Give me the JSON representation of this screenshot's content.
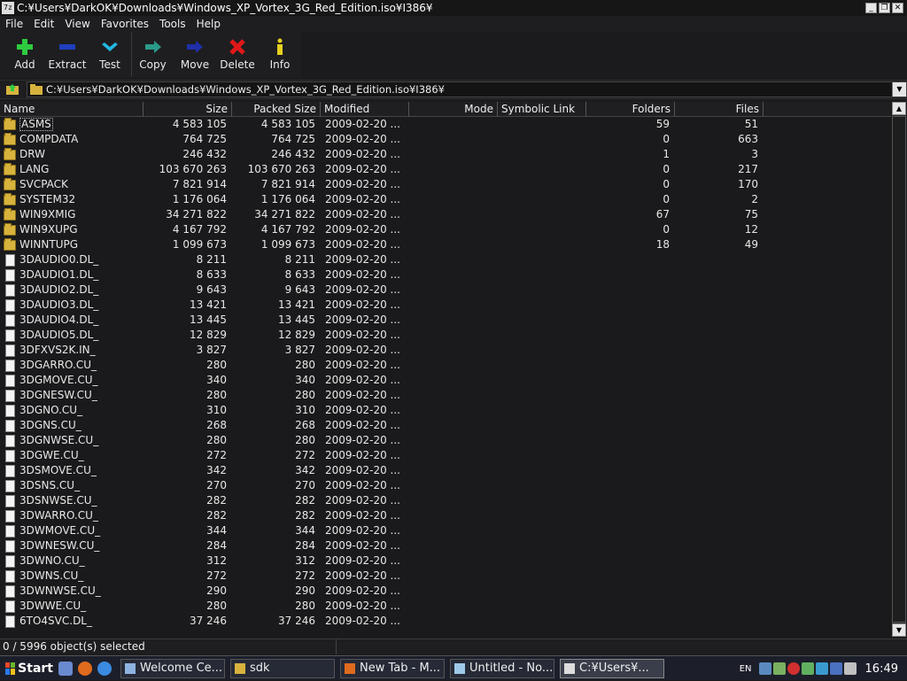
{
  "window": {
    "title": "C:¥Users¥DarkOK¥Downloads¥Windows_XP_Vortex_3G_Red_Edition.iso¥I386¥"
  },
  "menu": [
    "File",
    "Edit",
    "View",
    "Favorites",
    "Tools",
    "Help"
  ],
  "toolbar": [
    {
      "label": "Add",
      "icon": "plus-icon",
      "color": "#2ecc40"
    },
    {
      "label": "Extract",
      "icon": "minus-icon",
      "color": "#1f3fbf"
    },
    {
      "label": "Test",
      "icon": "check-icon",
      "color": "#22b8e0"
    },
    {
      "label": "Copy",
      "icon": "copy-arrow-icon",
      "color": "#2a9a8a"
    },
    {
      "label": "Move",
      "icon": "move-arrow-icon",
      "color": "#1f2fa8"
    },
    {
      "label": "Delete",
      "icon": "delete-x-icon",
      "color": "#e01818"
    },
    {
      "label": "Info",
      "icon": "info-icon",
      "color": "#e8d020"
    }
  ],
  "address": {
    "path": "C:¥Users¥DarkOK¥Downloads¥Windows_XP_Vortex_3G_Red_Edition.iso¥I386¥"
  },
  "columns": {
    "name": "Name",
    "size": "Size",
    "packed": "Packed Size",
    "modified": "Modified",
    "mode": "Mode",
    "symlink": "Symbolic Link",
    "folders": "Folders",
    "files": "Files"
  },
  "rows": [
    {
      "type": "folder",
      "name": "ASMS",
      "size": "4 583 105",
      "packed": "4 583 105",
      "modified": "2009-02-20 ...",
      "folders": "59",
      "files": "51"
    },
    {
      "type": "folder",
      "name": "COMPDATA",
      "size": "764 725",
      "packed": "764 725",
      "modified": "2009-02-20 ...",
      "folders": "0",
      "files": "663"
    },
    {
      "type": "folder",
      "name": "DRW",
      "size": "246 432",
      "packed": "246 432",
      "modified": "2009-02-20 ...",
      "folders": "1",
      "files": "3"
    },
    {
      "type": "folder",
      "name": "LANG",
      "size": "103 670 263",
      "packed": "103 670 263",
      "modified": "2009-02-20 ...",
      "folders": "0",
      "files": "217"
    },
    {
      "type": "folder",
      "name": "SVCPACK",
      "size": "7 821 914",
      "packed": "7 821 914",
      "modified": "2009-02-20 ...",
      "folders": "0",
      "files": "170"
    },
    {
      "type": "folder",
      "name": "SYSTEM32",
      "size": "1 176 064",
      "packed": "1 176 064",
      "modified": "2009-02-20 ...",
      "folders": "0",
      "files": "2"
    },
    {
      "type": "folder",
      "name": "WIN9XMIG",
      "size": "34 271 822",
      "packed": "34 271 822",
      "modified": "2009-02-20 ...",
      "folders": "67",
      "files": "75"
    },
    {
      "type": "folder",
      "name": "WIN9XUPG",
      "size": "4 167 792",
      "packed": "4 167 792",
      "modified": "2009-02-20 ...",
      "folders": "0",
      "files": "12"
    },
    {
      "type": "folder",
      "name": "WINNTUPG",
      "size": "1 099 673",
      "packed": "1 099 673",
      "modified": "2009-02-20 ...",
      "folders": "18",
      "files": "49"
    },
    {
      "type": "file",
      "name": "3DAUDIO0.DL_",
      "size": "8 211",
      "packed": "8 211",
      "modified": "2009-02-20 ...",
      "folders": "",
      "files": ""
    },
    {
      "type": "file",
      "name": "3DAUDIO1.DL_",
      "size": "8 633",
      "packed": "8 633",
      "modified": "2009-02-20 ...",
      "folders": "",
      "files": ""
    },
    {
      "type": "file",
      "name": "3DAUDIO2.DL_",
      "size": "9 643",
      "packed": "9 643",
      "modified": "2009-02-20 ...",
      "folders": "",
      "files": ""
    },
    {
      "type": "file",
      "name": "3DAUDIO3.DL_",
      "size": "13 421",
      "packed": "13 421",
      "modified": "2009-02-20 ...",
      "folders": "",
      "files": ""
    },
    {
      "type": "file",
      "name": "3DAUDIO4.DL_",
      "size": "13 445",
      "packed": "13 445",
      "modified": "2009-02-20 ...",
      "folders": "",
      "files": ""
    },
    {
      "type": "file",
      "name": "3DAUDIO5.DL_",
      "size": "12 829",
      "packed": "12 829",
      "modified": "2009-02-20 ...",
      "folders": "",
      "files": ""
    },
    {
      "type": "file",
      "name": "3DFXVS2K.IN_",
      "size": "3 827",
      "packed": "3 827",
      "modified": "2009-02-20 ...",
      "folders": "",
      "files": ""
    },
    {
      "type": "file",
      "name": "3DGARRO.CU_",
      "size": "280",
      "packed": "280",
      "modified": "2009-02-20 ...",
      "folders": "",
      "files": ""
    },
    {
      "type": "file",
      "name": "3DGMOVE.CU_",
      "size": "340",
      "packed": "340",
      "modified": "2009-02-20 ...",
      "folders": "",
      "files": ""
    },
    {
      "type": "file",
      "name": "3DGNESW.CU_",
      "size": "280",
      "packed": "280",
      "modified": "2009-02-20 ...",
      "folders": "",
      "files": ""
    },
    {
      "type": "file",
      "name": "3DGNO.CU_",
      "size": "310",
      "packed": "310",
      "modified": "2009-02-20 ...",
      "folders": "",
      "files": ""
    },
    {
      "type": "file",
      "name": "3DGNS.CU_",
      "size": "268",
      "packed": "268",
      "modified": "2009-02-20 ...",
      "folders": "",
      "files": ""
    },
    {
      "type": "file",
      "name": "3DGNWSE.CU_",
      "size": "280",
      "packed": "280",
      "modified": "2009-02-20 ...",
      "folders": "",
      "files": ""
    },
    {
      "type": "file",
      "name": "3DGWE.CU_",
      "size": "272",
      "packed": "272",
      "modified": "2009-02-20 ...",
      "folders": "",
      "files": ""
    },
    {
      "type": "file",
      "name": "3DSMOVE.CU_",
      "size": "342",
      "packed": "342",
      "modified": "2009-02-20 ...",
      "folders": "",
      "files": ""
    },
    {
      "type": "file",
      "name": "3DSNS.CU_",
      "size": "270",
      "packed": "270",
      "modified": "2009-02-20 ...",
      "folders": "",
      "files": ""
    },
    {
      "type": "file",
      "name": "3DSNWSE.CU_",
      "size": "282",
      "packed": "282",
      "modified": "2009-02-20 ...",
      "folders": "",
      "files": ""
    },
    {
      "type": "file",
      "name": "3DWARRO.CU_",
      "size": "282",
      "packed": "282",
      "modified": "2009-02-20 ...",
      "folders": "",
      "files": ""
    },
    {
      "type": "file",
      "name": "3DWMOVE.CU_",
      "size": "344",
      "packed": "344",
      "modified": "2009-02-20 ...",
      "folders": "",
      "files": ""
    },
    {
      "type": "file",
      "name": "3DWNESW.CU_",
      "size": "284",
      "packed": "284",
      "modified": "2009-02-20 ...",
      "folders": "",
      "files": ""
    },
    {
      "type": "file",
      "name": "3DWNO.CU_",
      "size": "312",
      "packed": "312",
      "modified": "2009-02-20 ...",
      "folders": "",
      "files": ""
    },
    {
      "type": "file",
      "name": "3DWNS.CU_",
      "size": "272",
      "packed": "272",
      "modified": "2009-02-20 ...",
      "folders": "",
      "files": ""
    },
    {
      "type": "file",
      "name": "3DWNWSE.CU_",
      "size": "290",
      "packed": "290",
      "modified": "2009-02-20 ...",
      "folders": "",
      "files": ""
    },
    {
      "type": "file",
      "name": "3DWWE.CU_",
      "size": "280",
      "packed": "280",
      "modified": "2009-02-20 ...",
      "folders": "",
      "files": ""
    },
    {
      "type": "file",
      "name": "6TO4SVC.DL_",
      "size": "37 246",
      "packed": "37 246",
      "modified": "2009-02-20 ...",
      "folders": "",
      "files": ""
    }
  ],
  "status": {
    "text": "0 / 5996 object(s) selected"
  },
  "taskbar": {
    "start": "Start",
    "tasks": [
      {
        "label": "Welcome Ce...",
        "icon": "window-icon",
        "color": "#8fb3e0"
      },
      {
        "label": "sdk",
        "icon": "folder-icon",
        "color": "#d7b33d"
      },
      {
        "label": "New Tab - M...",
        "icon": "firefox-icon",
        "color": "#e06b1f"
      },
      {
        "label": "Untitled - No...",
        "icon": "notepad-icon",
        "color": "#9fc9e8"
      },
      {
        "label": "C:¥Users¥...",
        "icon": "7zip-icon",
        "color": "#dddddd"
      }
    ],
    "lang": "EN",
    "clock": "16:49"
  }
}
